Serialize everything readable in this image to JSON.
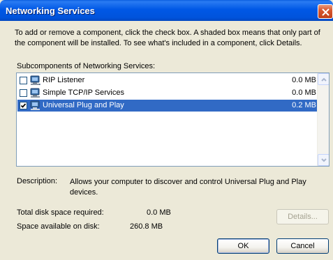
{
  "window": {
    "title": "Networking Services",
    "close_icon": "close-icon"
  },
  "intro_text": "To add or remove a component, click the check box. A shaded box means that only part of the component will be installed. To see what's included in a component, click Details.",
  "list": {
    "label": "Subcomponents of Networking Services:",
    "items": [
      {
        "label": "RIP Listener",
        "size": "0.0 MB",
        "checked": false,
        "selected": false,
        "icon": "network-computer-icon"
      },
      {
        "label": "Simple TCP/IP Services",
        "size": "0.0 MB",
        "checked": false,
        "selected": false,
        "icon": "network-computer-icon"
      },
      {
        "label": "Universal Plug and Play",
        "size": "0.2 MB",
        "checked": true,
        "selected": true,
        "icon": "network-computer-icon"
      }
    ]
  },
  "description": {
    "label": "Description:",
    "text": "Allows your computer to discover and control Universal Plug and Play devices."
  },
  "disk": {
    "required_label": "Total disk space required:",
    "required_value": "0.0 MB",
    "available_label": "Space available on disk:",
    "available_value": "260.8 MB"
  },
  "buttons": {
    "details": "Details...",
    "ok": "OK",
    "cancel": "Cancel"
  },
  "colors": {
    "titlebar": "#0058E6",
    "dialog_bg": "#ECE9D8",
    "selection": "#316AC5",
    "close_button": "#D8572F"
  }
}
